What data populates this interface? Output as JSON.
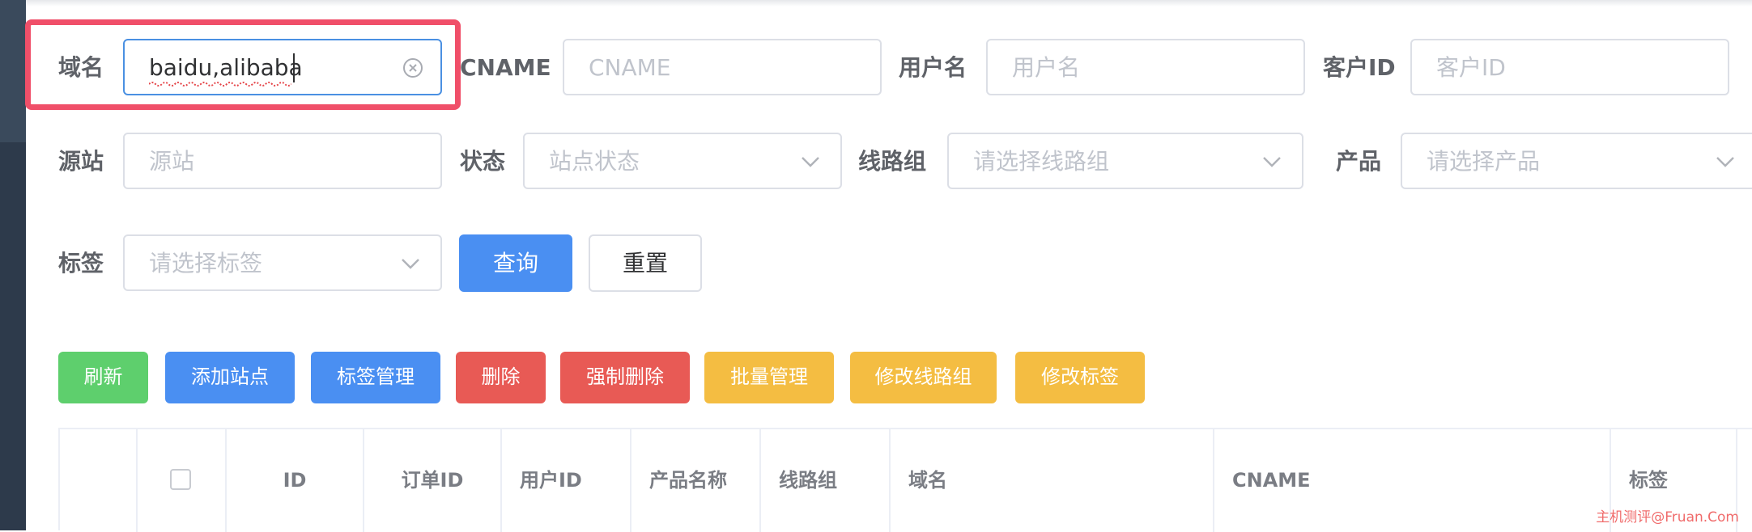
{
  "search_form": {
    "domain": {
      "label": "域名",
      "value": "baidu,alibaba"
    },
    "cname": {
      "label": "CNAME",
      "placeholder": "CNAME"
    },
    "username": {
      "label": "用户名",
      "placeholder": "用户名"
    },
    "customer_id": {
      "label": "客户ID",
      "placeholder": "客户ID"
    },
    "origin": {
      "label": "源站",
      "placeholder": "源站"
    },
    "status": {
      "label": "状态",
      "placeholder": "站点状态"
    },
    "line_group": {
      "label": "线路组",
      "placeholder": "请选择线路组"
    },
    "product": {
      "label": "产品",
      "placeholder": "请选择产品"
    },
    "tag": {
      "label": "标签",
      "placeholder": "请选择标签"
    },
    "query_label": "查询",
    "reset_label": "重置"
  },
  "toolbar": {
    "refresh": "刷新",
    "add_site": "添加站点",
    "tag_manage": "标签管理",
    "delete": "删除",
    "force_delete": "强制删除",
    "batch_manage": "批量管理",
    "edit_line_group": "修改线路组",
    "edit_tag": "修改标签"
  },
  "table": {
    "columns": [
      "ID",
      "订单ID",
      "用户ID",
      "产品名称",
      "线路组",
      "域名",
      "CNAME",
      "标签"
    ]
  },
  "watermark": "主机测评@Fruan.Com",
  "colors": {
    "primary": "#4a8ff2",
    "success": "#5ecf6d",
    "danger": "#e85a55",
    "warning": "#f4bd42",
    "highlight": "#f04f69"
  }
}
